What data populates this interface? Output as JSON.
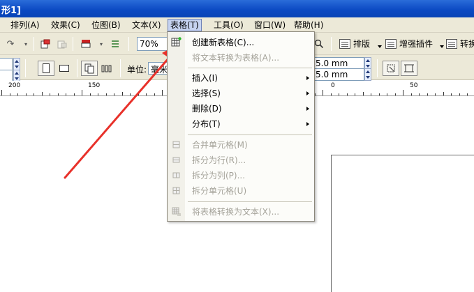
{
  "window": {
    "title_fragment": "形1]"
  },
  "menubar": {
    "items": [
      {
        "label": "排列(A)"
      },
      {
        "label": "效果(C)"
      },
      {
        "label": "位图(B)"
      },
      {
        "label": "文本(X)"
      },
      {
        "label": "表格(T)"
      },
      {
        "label": "工具(O)"
      },
      {
        "label": "窗口(W)"
      },
      {
        "label": "帮助(H)"
      }
    ]
  },
  "toolbar": {
    "zoom_value": "70%",
    "layout_label": "排版",
    "enhance_plugin_label": "增强插件",
    "convert_label": "转换"
  },
  "propertybar": {
    "unit_label": "单位:",
    "unit_value": "毫米",
    "nudge_x": "5.0 mm",
    "nudge_y": "5.0 mm"
  },
  "ruler": {
    "labels": [
      "200",
      "150",
      "0",
      "50"
    ]
  },
  "table_menu": {
    "items": [
      {
        "label": "创建新表格(C)...",
        "enabled": true
      },
      {
        "label": "将文本转换为表格(A)...",
        "enabled": false
      },
      {
        "label": "插入(I)",
        "enabled": true,
        "submenu": true
      },
      {
        "label": "选择(S)",
        "enabled": true,
        "submenu": true
      },
      {
        "label": "删除(D)",
        "enabled": true,
        "submenu": true
      },
      {
        "label": "分布(T)",
        "enabled": true,
        "submenu": true
      },
      {
        "label": "合并单元格(M)",
        "enabled": false
      },
      {
        "label": "拆分为行(R)...",
        "enabled": false
      },
      {
        "label": "拆分为列(P)...",
        "enabled": false
      },
      {
        "label": "拆分单元格(U)",
        "enabled": false
      },
      {
        "label": "将表格转换为文本(X)...",
        "enabled": false
      }
    ]
  },
  "colors": {
    "menu_highlight": "#c6d3f0",
    "annotation_arrow": "#e8312a",
    "title_bar": "#0a48c2"
  }
}
